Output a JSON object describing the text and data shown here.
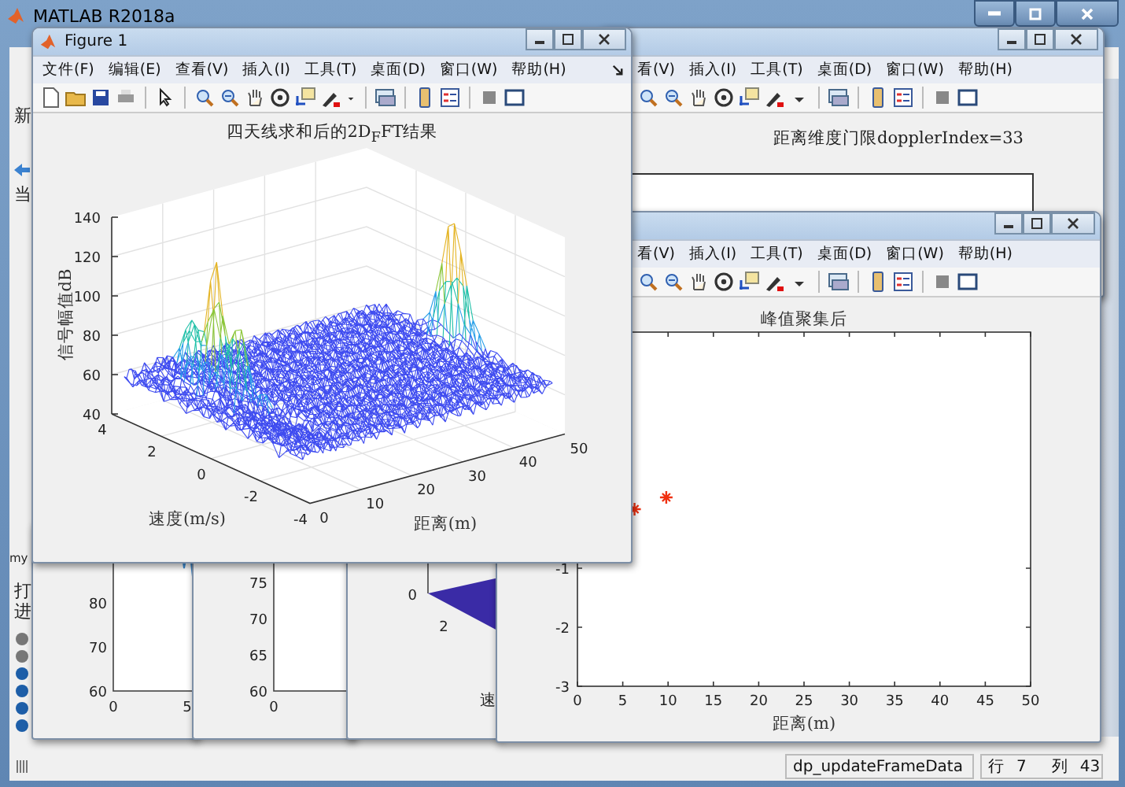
{
  "app_window": {
    "title": "MATLAB R2018a",
    "left_strip": [
      "新",
      "当",
      "my",
      "打",
      "进"
    ],
    "status_bar": {
      "message": "dp_updateFrameData",
      "row_label": "行",
      "row": "7",
      "col_label": "列",
      "col": "43"
    }
  },
  "figure_1": {
    "title": "Figure 1",
    "menu": [
      "文件(F)",
      "编辑(E)",
      "查看(V)",
      "插入(I)",
      "工具(T)",
      "桌面(D)",
      "窗口(W)",
      "帮助(H)"
    ],
    "plot": {
      "title": "四天线求和后的2D$_{F}$FT结果",
      "zlabel": "信号幅值dB",
      "z_ticks": [
        "140",
        "120",
        "100",
        "80",
        "60",
        "40"
      ],
      "y_ticks": [
        "4",
        "2",
        "0",
        "-2",
        "-4"
      ],
      "ylabel": "速度(m/s)",
      "x_ticks": [
        "0",
        "10",
        "20",
        "30",
        "40",
        "50"
      ],
      "xlabel": "距离(m)"
    }
  },
  "figure_2": {
    "menu": [
      "看(V)",
      "插入(I)",
      "工具(T)",
      "桌面(D)",
      "窗口(W)",
      "帮助(H)"
    ],
    "plot_title": "距离维度门限dopplerIndex=33"
  },
  "figure_3": {
    "menu": [
      "看(V)",
      "插入(I)",
      "工具(T)",
      "桌面(D)",
      "窗口(W)",
      "帮助(H)"
    ],
    "chart_data": {
      "type": "scatter",
      "title": "峰值聚集后",
      "xlabel": "距离(m)",
      "x": [
        6.3,
        9.8
      ],
      "values": [
        0,
        0.2
      ],
      "xlim": [
        0,
        50
      ],
      "ylim": [
        -3,
        3
      ],
      "xticks": [
        0,
        5,
        10,
        15,
        20,
        25,
        30,
        35,
        40,
        45,
        50
      ],
      "yticks": [
        -3,
        -2,
        -1
      ]
    }
  },
  "small_figures": [
    {
      "y_ticks": [
        "80",
        "70",
        "60"
      ],
      "x_ticks": [
        "0",
        "5"
      ]
    },
    {
      "y_ticks": [
        "75",
        "70",
        "65",
        "60"
      ],
      "x_ticks": [
        "0"
      ]
    },
    {
      "y_ticks": [
        "0"
      ],
      "x_ticks": [
        "2"
      ],
      "xlabel": "速"
    }
  ]
}
